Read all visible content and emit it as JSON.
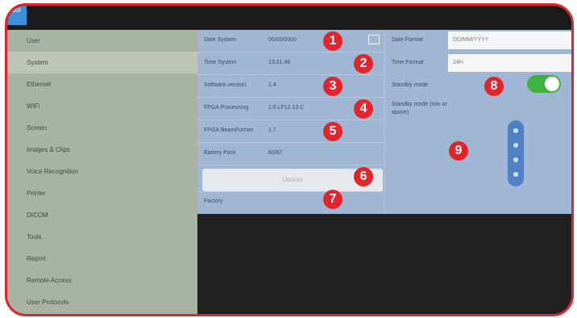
{
  "header": {
    "tab_label": "Tool"
  },
  "sidebar": {
    "items": [
      {
        "label": "User"
      },
      {
        "label": "System"
      },
      {
        "label": "Ethernet"
      },
      {
        "label": "WiFi"
      },
      {
        "label": "Screen"
      },
      {
        "label": "Images & Clips"
      },
      {
        "label": "Voice Recognition"
      },
      {
        "label": "Printer"
      },
      {
        "label": "DICOM"
      },
      {
        "label": "Tools"
      },
      {
        "label": "Report"
      },
      {
        "label": "Remote Access"
      },
      {
        "label": "User Protocols"
      }
    ],
    "selected": "System"
  },
  "system": {
    "date_label": "Date System",
    "date_value": "00/00/0000",
    "time_label": "Time System",
    "time_value": "13:21:48",
    "software_label": "Software version",
    "software_value": "1.4",
    "fpga_processing_label": "FPGA Processing",
    "fpga_processing_value": "1.6 LF12.13.C",
    "fpga_beamformer_label": "FPGA BeamFormer",
    "fpga_beamformer_value": "1.7",
    "battery_label": "Battery Pack",
    "battery_value": "60/87",
    "update_label": "Update",
    "factory_label": "Factory"
  },
  "right": {
    "date_format_label": "Date Format",
    "date_format_value": "DD/MM/YYYY",
    "time_format_label": "Time Format",
    "time_format_value": "24H",
    "standby_label": "Standby mode",
    "standby_on": true,
    "standby_time_label": "Standby mode (min or above)"
  },
  "callouts": [
    "1",
    "2",
    "3",
    "4",
    "5",
    "6",
    "7",
    "8",
    "9"
  ],
  "colors": {
    "accent_red": "#e3242b",
    "toggle_green": "#40b33e",
    "panel_blue": "#9fb7d5",
    "sidebar_gray": "#a8b3a4"
  }
}
